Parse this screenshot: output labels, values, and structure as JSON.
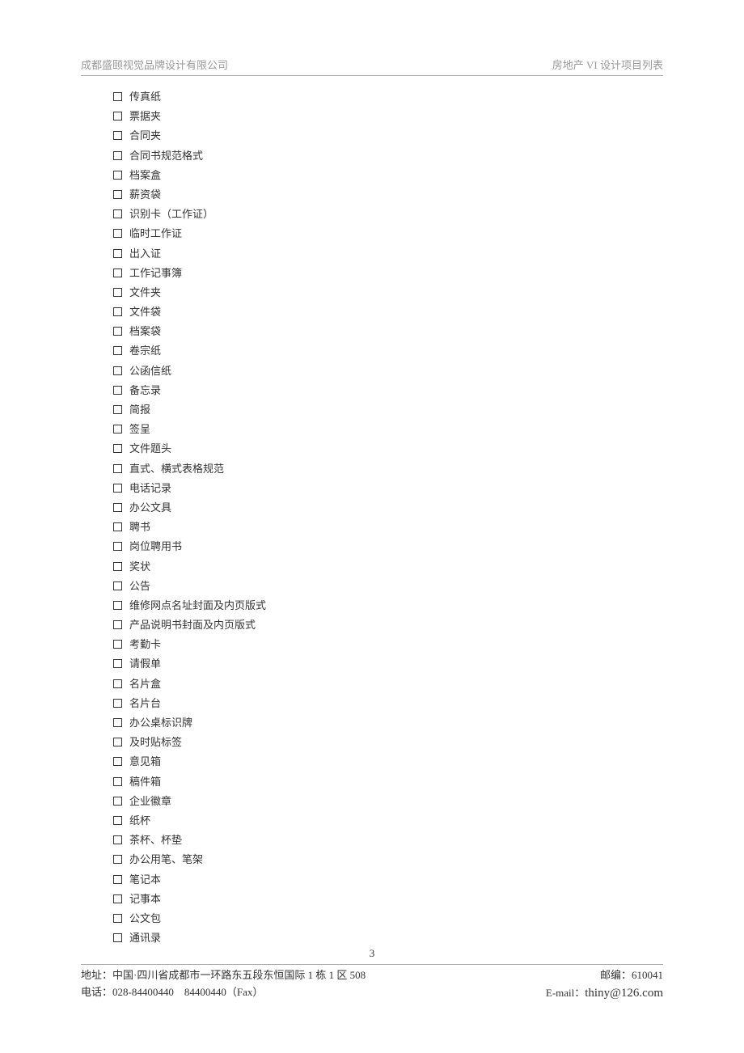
{
  "header": {
    "left": "成都盛颐视觉品牌设计有限公司",
    "right": "房地产 VI 设计项目列表"
  },
  "items": [
    "传真纸",
    "票据夹",
    "合同夹",
    "合同书规范格式",
    "档案盒",
    "薪资袋",
    "识别卡（工作证）",
    "临时工作证",
    "出入证",
    "工作记事簿",
    "文件夹",
    "文件袋",
    "档案袋",
    "卷宗纸",
    "公函信纸",
    "备忘录",
    "简报",
    "签呈",
    "文件题头",
    "直式、横式表格规范",
    "电话记录",
    "办公文具",
    "聘书",
    "岗位聘用书",
    "奖状",
    "公告",
    "维修网点名址封面及内页版式",
    "产品说明书封面及内页版式",
    "考勤卡",
    "请假单",
    "名片盒",
    "名片台",
    "办公桌标识牌",
    "及时贴标签",
    "意见箱",
    "稿件箱",
    "企业徽章",
    "纸杯",
    "茶杯、杯垫",
    "办公用笔、笔架",
    "笔记本",
    "记事本",
    "公文包",
    "通讯录"
  ],
  "pageNumber": "3",
  "footer": {
    "addressLabel": "地址：",
    "addressValue": "中国·四川省成都市一环路东五段东恒国际 1 栋 1 区 508",
    "postcodeLabel": "邮编：",
    "postcodeValue": "610041",
    "phoneLabel": "电话：",
    "phoneValue": "028-84400440",
    "faxValue": "84400440（Fax）",
    "emailLabel": "E-mail：",
    "emailValue": "thiny@126.com"
  }
}
